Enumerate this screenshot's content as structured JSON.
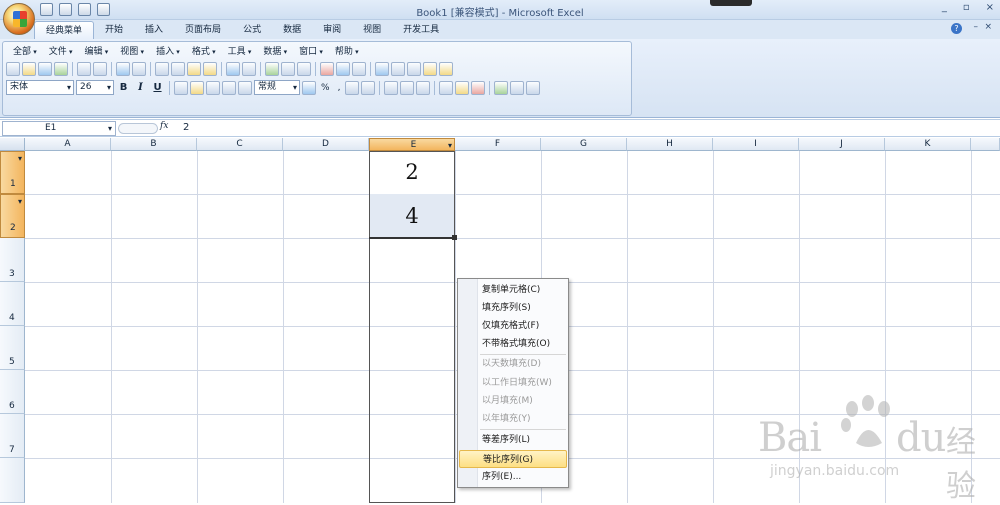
{
  "window": {
    "title": "Book1  [兼容模式] - Microsoft Excel",
    "controls": [
      "_",
      "▫",
      "×"
    ]
  },
  "ribbon_tabs": [
    "经典菜单",
    "开始",
    "插入",
    "页面布局",
    "公式",
    "数据",
    "审阅",
    "视图",
    "开发工具"
  ],
  "active_tab": "经典菜单",
  "classic_menu": [
    "全部",
    "文件",
    "编辑",
    "视图",
    "插入",
    "格式",
    "工具",
    "数据",
    "窗口",
    "帮助"
  ],
  "format": {
    "font_name": "宋体",
    "font_size": "26",
    "bold": "B",
    "italic": "I",
    "underline": "U",
    "number_format": "常规",
    "percent": "%",
    "comma": ","
  },
  "formula_bar": {
    "name_box": "E1",
    "fx": "fx",
    "value": "2"
  },
  "columns": [
    "A",
    "B",
    "C",
    "D",
    "E",
    "F",
    "G",
    "H",
    "I",
    "J",
    "K"
  ],
  "selected_column": "E",
  "rows": [
    "1",
    "2",
    "3",
    "4",
    "5",
    "6",
    "7"
  ],
  "cells": {
    "E1": "2",
    "E2": "4"
  },
  "context_menu": {
    "items": [
      {
        "label": "复制单元格(C)",
        "enabled": true
      },
      {
        "label": "填充序列(S)",
        "enabled": true
      },
      {
        "label": "仅填充格式(F)",
        "enabled": true
      },
      {
        "label": "不带格式填充(O)",
        "enabled": true
      },
      {
        "label": "以天数填充(D)",
        "enabled": false
      },
      {
        "label": "以工作日填充(W)",
        "enabled": false
      },
      {
        "label": "以月填充(M)",
        "enabled": false
      },
      {
        "label": "以年填充(Y)",
        "enabled": false
      },
      {
        "label": "等差序列(L)",
        "enabled": true
      },
      {
        "label": "等比序列(G)",
        "enabled": true,
        "highlighted": true
      },
      {
        "label": "序列(E)...",
        "enabled": true
      }
    ]
  },
  "watermark": {
    "brand": "Bai",
    "brand2": "du",
    "cn": "经验",
    "url": "jingyan.baidu.com"
  },
  "colors": {
    "accent": "#f3b55e",
    "ribbon": "#d6e3f3",
    "highlight": "#fddf84"
  }
}
